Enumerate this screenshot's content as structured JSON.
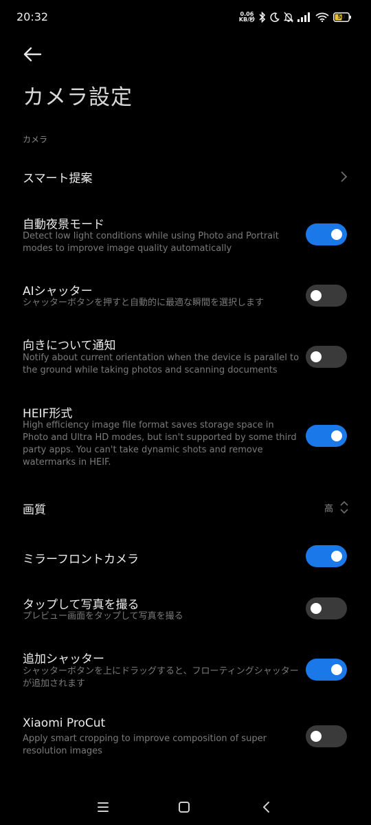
{
  "status_bar": {
    "time": "20:32",
    "net_speed_value": "0.06",
    "net_speed_unit": "KB/秒",
    "battery_level": "50"
  },
  "header": {
    "title": "カメラ設定"
  },
  "section": {
    "label": "カメラ"
  },
  "settings": {
    "smart_suggestions": {
      "title": "スマート提案"
    },
    "auto_night": {
      "title": "自動夜景モード",
      "desc": "Detect low light conditions while using Photo and Portrait modes to improve image quality automatically",
      "enabled": true
    },
    "ai_shutter": {
      "title": "AIシャッター",
      "desc": "シャッターボタンを押すと自動的に最適な瞬間を選択します",
      "enabled": false
    },
    "orientation_notice": {
      "title": "向きについて通知",
      "desc": "Notify about current orientation when the device is parallel to the ground while taking photos and scanning documents",
      "enabled": false
    },
    "heif": {
      "title": "HEIF形式",
      "desc": "High efficiency image file format saves storage space in Photo and Ultra HD modes, but isn't supported by some third party apps. You can't take dynamic shots and remove watermarks in HEIF.",
      "enabled": true
    },
    "image_quality": {
      "title": "画質",
      "value": "高"
    },
    "mirror_front": {
      "title": "ミラーフロントカメラ",
      "enabled": true
    },
    "tap_to_shoot": {
      "title": "タップして写真を撮る",
      "desc": "プレビュー画面をタップして写真を撮る",
      "enabled": false
    },
    "extra_shutter": {
      "title": "追加シャッター",
      "desc": "シャッターボタンを上にドラッグすると、フローティングシャッターが追加されます",
      "enabled": true
    },
    "procut": {
      "title": "Xiaomi ProCut",
      "desc": "Apply smart cropping to improve composition of super resolution images",
      "enabled": false
    }
  },
  "colors": {
    "background": "#000000",
    "toggle_on": "#1a78e8",
    "toggle_off": "#3a3a3a",
    "text_primary": "#ececec",
    "text_secondary": "#7b7b7b"
  },
  "icons": {
    "back": "back-arrow-icon",
    "bluetooth": "bluetooth-icon",
    "dnd": "moon-icon",
    "mute": "bell-off-icon",
    "signal": "signal-icon",
    "wifi": "wifi-icon",
    "battery": "battery-icon",
    "chevron_right": "chevron-right-icon",
    "up_down": "chevron-up-down-icon",
    "nav_menu": "menu-icon",
    "nav_home": "home-icon",
    "nav_back": "nav-back-icon"
  }
}
